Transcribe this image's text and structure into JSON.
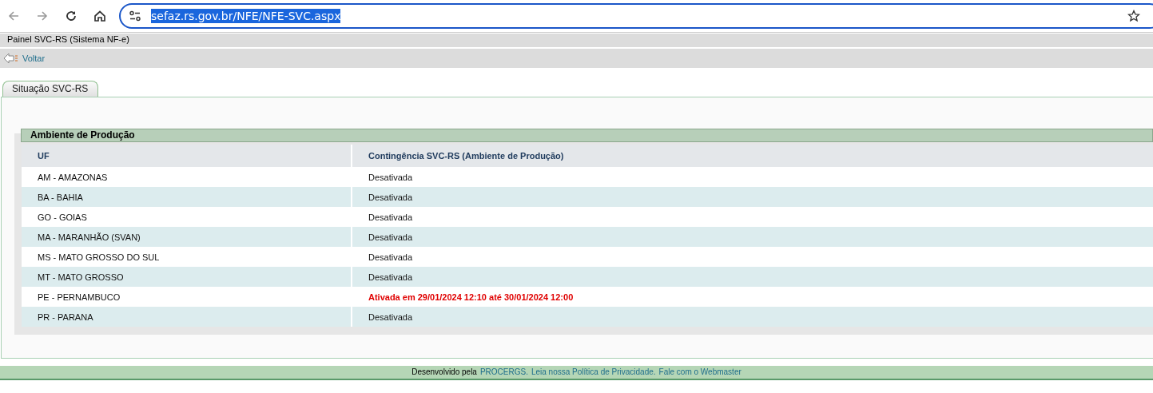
{
  "browser": {
    "url": "sefaz.rs.gov.br/NFE/NFE-SVC.aspx"
  },
  "header": {
    "title": "Painel SVC-RS (Sistema NF-e)",
    "back_link": "Voltar"
  },
  "tabs": [
    {
      "label": "Situação SVC-RS",
      "selected": true
    }
  ],
  "section": {
    "title": "Ambiente de Produção",
    "table": {
      "columns": [
        "UF",
        "Contingência SVC-RS (Ambiente de Produção)"
      ],
      "rows": [
        {
          "uf": "AM - AMAZONAS",
          "status": "Desativada",
          "active": false
        },
        {
          "uf": "BA - BAHIA",
          "status": "Desativada",
          "active": false
        },
        {
          "uf": "GO - GOIAS",
          "status": "Desativada",
          "active": false
        },
        {
          "uf": "MA - MARANHÃO (SVAN)",
          "status": "Desativada",
          "active": false
        },
        {
          "uf": "MS - MATO GROSSO DO SUL",
          "status": "Desativada",
          "active": false
        },
        {
          "uf": "MT - MATO GROSSO",
          "status": "Desativada",
          "active": false
        },
        {
          "uf": "PE - PERNAMBUCO",
          "status": "Ativada em 29/01/2024 12:10 até 30/01/2024 12:00",
          "active": true
        },
        {
          "uf": "PR - PARANA",
          "status": "Desativada",
          "active": false
        }
      ]
    }
  },
  "footer": [
    {
      "kind": "text",
      "text": "Desenvolvido pela"
    },
    {
      "kind": "link",
      "text": "PROCERGS."
    },
    {
      "kind": "link",
      "text": "Leia nossa Política de Privacidade."
    },
    {
      "kind": "link",
      "text": "Fale com o Webmaster"
    }
  ]
}
